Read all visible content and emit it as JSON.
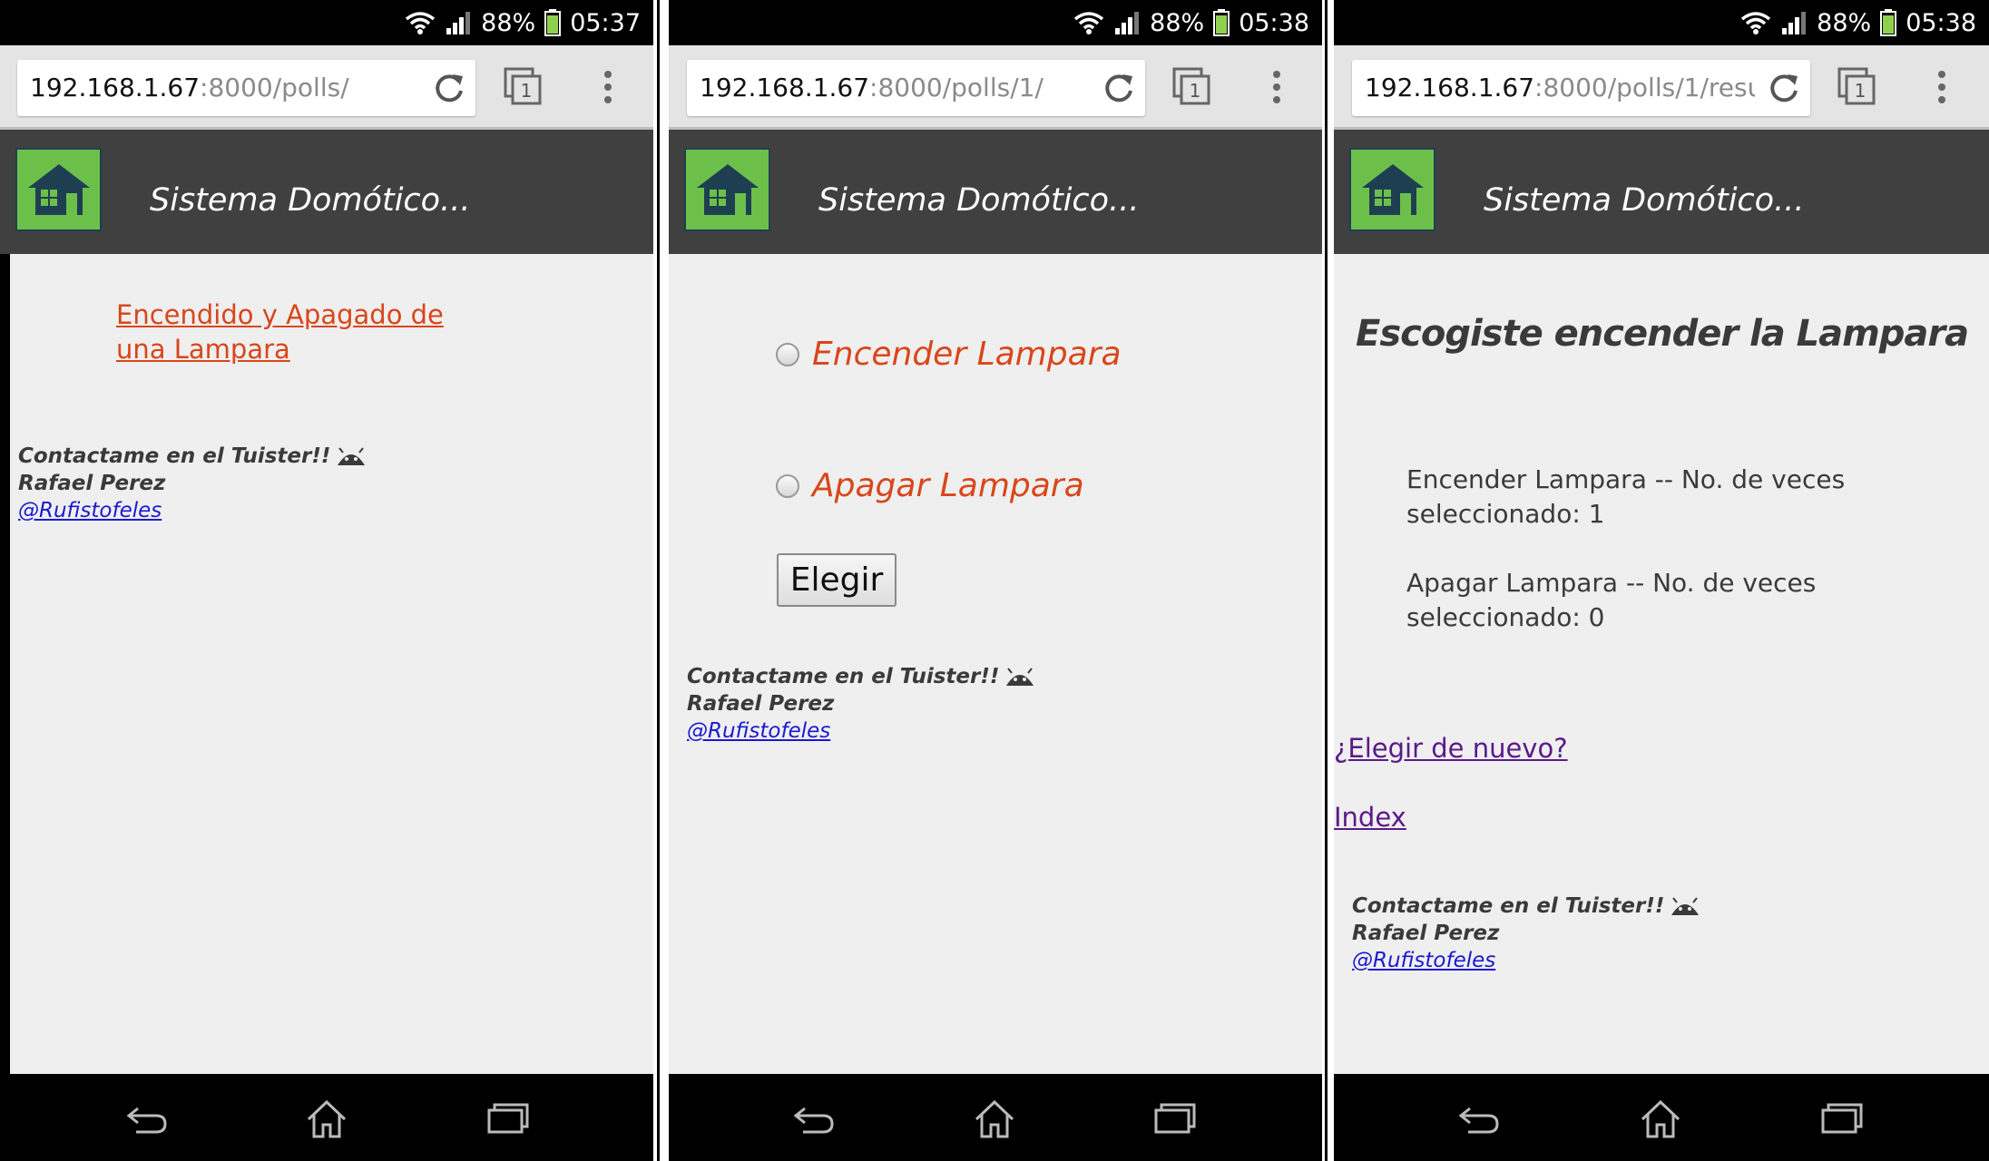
{
  "status": [
    {
      "battery": "88%",
      "time": "05:37"
    },
    {
      "battery": "88%",
      "time": "05:38"
    },
    {
      "battery": "88%",
      "time": "05:38"
    }
  ],
  "urls": [
    {
      "host": "192.168.1.67",
      "path": ":8000/polls/"
    },
    {
      "host": "192.168.1.67",
      "path": ":8000/polls/1/"
    },
    {
      "host": "192.168.1.67",
      "path": ":8000/polls/1/resu"
    }
  ],
  "tabs_count": "1",
  "site_title": "Sistema Domótico...",
  "index_page": {
    "poll_link": "Encendido y Apagado de una Lampara"
  },
  "detail_page": {
    "choices": [
      "Encender Lampara",
      "Apagar Lampara"
    ],
    "submit_label": "Elegir"
  },
  "results_page": {
    "heading": "Escogiste encender la Lampara",
    "results": [
      "Encender Lampara -- No. de veces seleccionado: 1",
      "Apagar Lampara -- No. de veces seleccionado: 0"
    ],
    "again_link": "¿Elegir de nuevo?",
    "index_link": "Index"
  },
  "footer": {
    "contact": "Contactame en el Tuister!!",
    "name": "Rafael Perez",
    "handle": "@Rufistofeles"
  },
  "colors": {
    "link_orange": "#d9461a",
    "banner": "#404040",
    "logo_green": "#6cc04a",
    "visited_link": "#5a1a8a"
  }
}
